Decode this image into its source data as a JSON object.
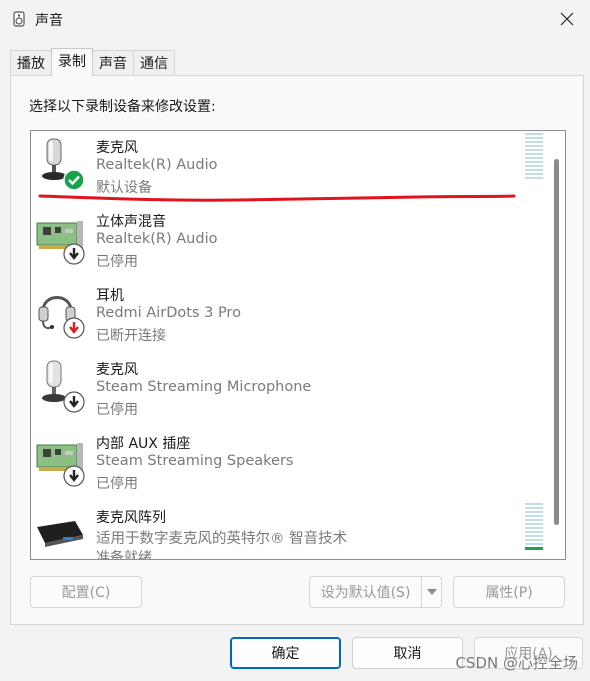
{
  "window": {
    "title": "声音",
    "icon": "speaker-icon"
  },
  "tabs": [
    {
      "label": "播放",
      "active": false
    },
    {
      "label": "录制",
      "active": true
    },
    {
      "label": "声音",
      "active": false
    },
    {
      "label": "通信",
      "active": false
    }
  ],
  "instruction": "选择以下录制设备来修改设置:",
  "devices": [
    {
      "name": "麦克风",
      "sub": "Realtek(R) Audio",
      "status": "默认设备",
      "icon": "microphone-icon",
      "badge": "check-badge-icon",
      "level": 0.1
    },
    {
      "name": "立体声混音",
      "sub": "Realtek(R) Audio",
      "status": "已停用",
      "icon": "sound-card-icon",
      "badge": "disabled-arrow-icon"
    },
    {
      "name": "耳机",
      "sub": "Redmi AirDots 3 Pro",
      "status": "已断开连接",
      "icon": "headset-icon",
      "badge": "disconnected-arrow-icon"
    },
    {
      "name": "麦克风",
      "sub": "Steam Streaming Microphone",
      "status": "已停用",
      "icon": "microphone-icon",
      "badge": "disabled-arrow-icon"
    },
    {
      "name": "内部 AUX 插座",
      "sub": "Steam Streaming Speakers",
      "status": "已停用",
      "icon": "sound-card-icon",
      "badge": "disabled-arrow-icon"
    },
    {
      "name": "麦克风阵列",
      "sub": "适用于数字麦克风的英特尔® 智音技术",
      "status": "准备就绪",
      "icon": "mic-array-icon",
      "level": 0.08
    }
  ],
  "buttons": {
    "configure": "配置(C)",
    "set_default": "设为默认值(S)",
    "properties": "属性(P)",
    "ok": "确定",
    "cancel": "取消",
    "apply": "应用(A)"
  },
  "watermark": "CSDN @心控全场",
  "colors": {
    "accent": "#0067c0",
    "annotation": "#e0141e",
    "check": "#16a34a",
    "disabled_red": "#d32020"
  }
}
